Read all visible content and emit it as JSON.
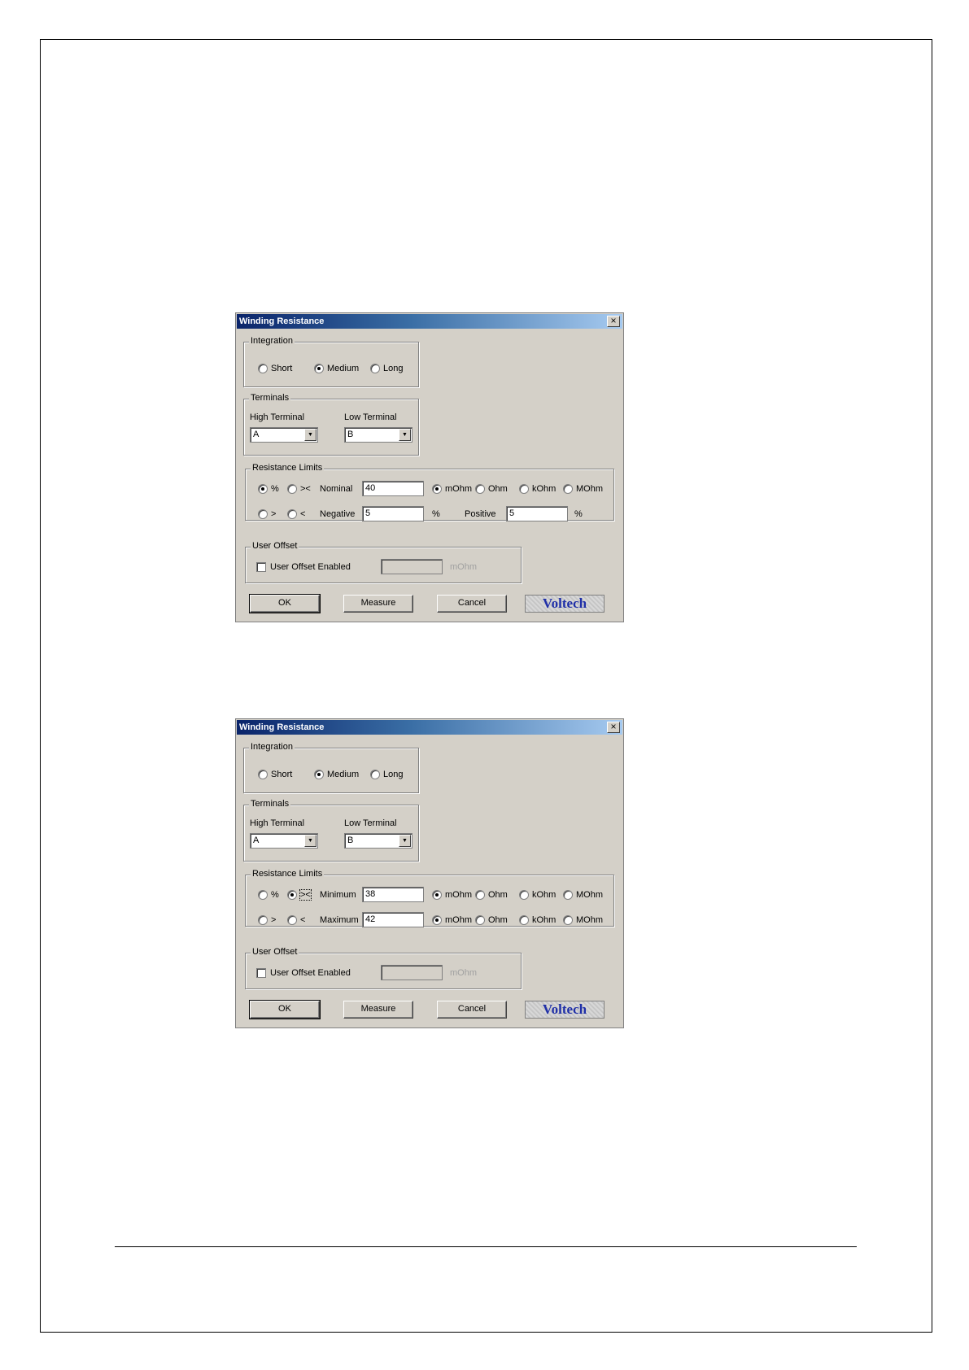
{
  "dialogs": [
    {
      "title": "Winding Resistance",
      "close_label": "×",
      "integration": {
        "label": "Integration",
        "options": [
          {
            "label": "Short",
            "checked": false
          },
          {
            "label": "Medium",
            "checked": true
          },
          {
            "label": "Long",
            "checked": false
          }
        ]
      },
      "terminals": {
        "label": "Terminals",
        "high_label": "High Terminal",
        "high_value": "A",
        "low_label": "Low Terminal",
        "low_value": "B"
      },
      "limits": {
        "label": "Resistance Limits",
        "mode1": "%",
        "mode2": "><",
        "mode3": ">",
        "mode4": "<",
        "selected_mode": "%",
        "row1_label": "Nominal",
        "row1_value": "40",
        "row1_units": [
          "mOhm",
          "Ohm",
          "kOhm",
          "MOhm"
        ],
        "row1_selected_unit": "mOhm",
        "row2_label": "Negative",
        "row2_value": "5",
        "row2_suffix": "%",
        "row2b_label": "Positive",
        "row2b_value": "5",
        "row2b_suffix": "%"
      },
      "offset": {
        "label": "User Offset",
        "checkbox_label": "User Offset Enabled",
        "value": "",
        "unit": "mOhm"
      },
      "buttons": {
        "ok": "OK",
        "measure": "Measure",
        "cancel": "Cancel"
      },
      "logo": "Voltech"
    },
    {
      "title": "Winding Resistance",
      "close_label": "×",
      "integration": {
        "label": "Integration",
        "options": [
          {
            "label": "Short",
            "checked": false
          },
          {
            "label": "Medium",
            "checked": true
          },
          {
            "label": "Long",
            "checked": false
          }
        ]
      },
      "terminals": {
        "label": "Terminals",
        "high_label": "High Terminal",
        "high_value": "A",
        "low_label": "Low Terminal",
        "low_value": "B"
      },
      "limits": {
        "label": "Resistance Limits",
        "mode1": "%",
        "mode2": "><",
        "mode3": ">",
        "mode4": "<",
        "selected_mode": "><",
        "row1_label": "Minimum",
        "row1_value": "38",
        "row1_units": [
          "mOhm",
          "Ohm",
          "kOhm",
          "MOhm"
        ],
        "row1_selected_unit": "mOhm",
        "row2_label": "Maximum",
        "row2_value": "42",
        "row2_units": [
          "mOhm",
          "Ohm",
          "kOhm",
          "MOhm"
        ],
        "row2_selected_unit": "mOhm"
      },
      "offset": {
        "label": "User Offset",
        "checkbox_label": "User Offset Enabled",
        "value": "",
        "unit": "mOhm"
      },
      "buttons": {
        "ok": "OK",
        "measure": "Measure",
        "cancel": "Cancel"
      },
      "logo": "Voltech"
    }
  ]
}
